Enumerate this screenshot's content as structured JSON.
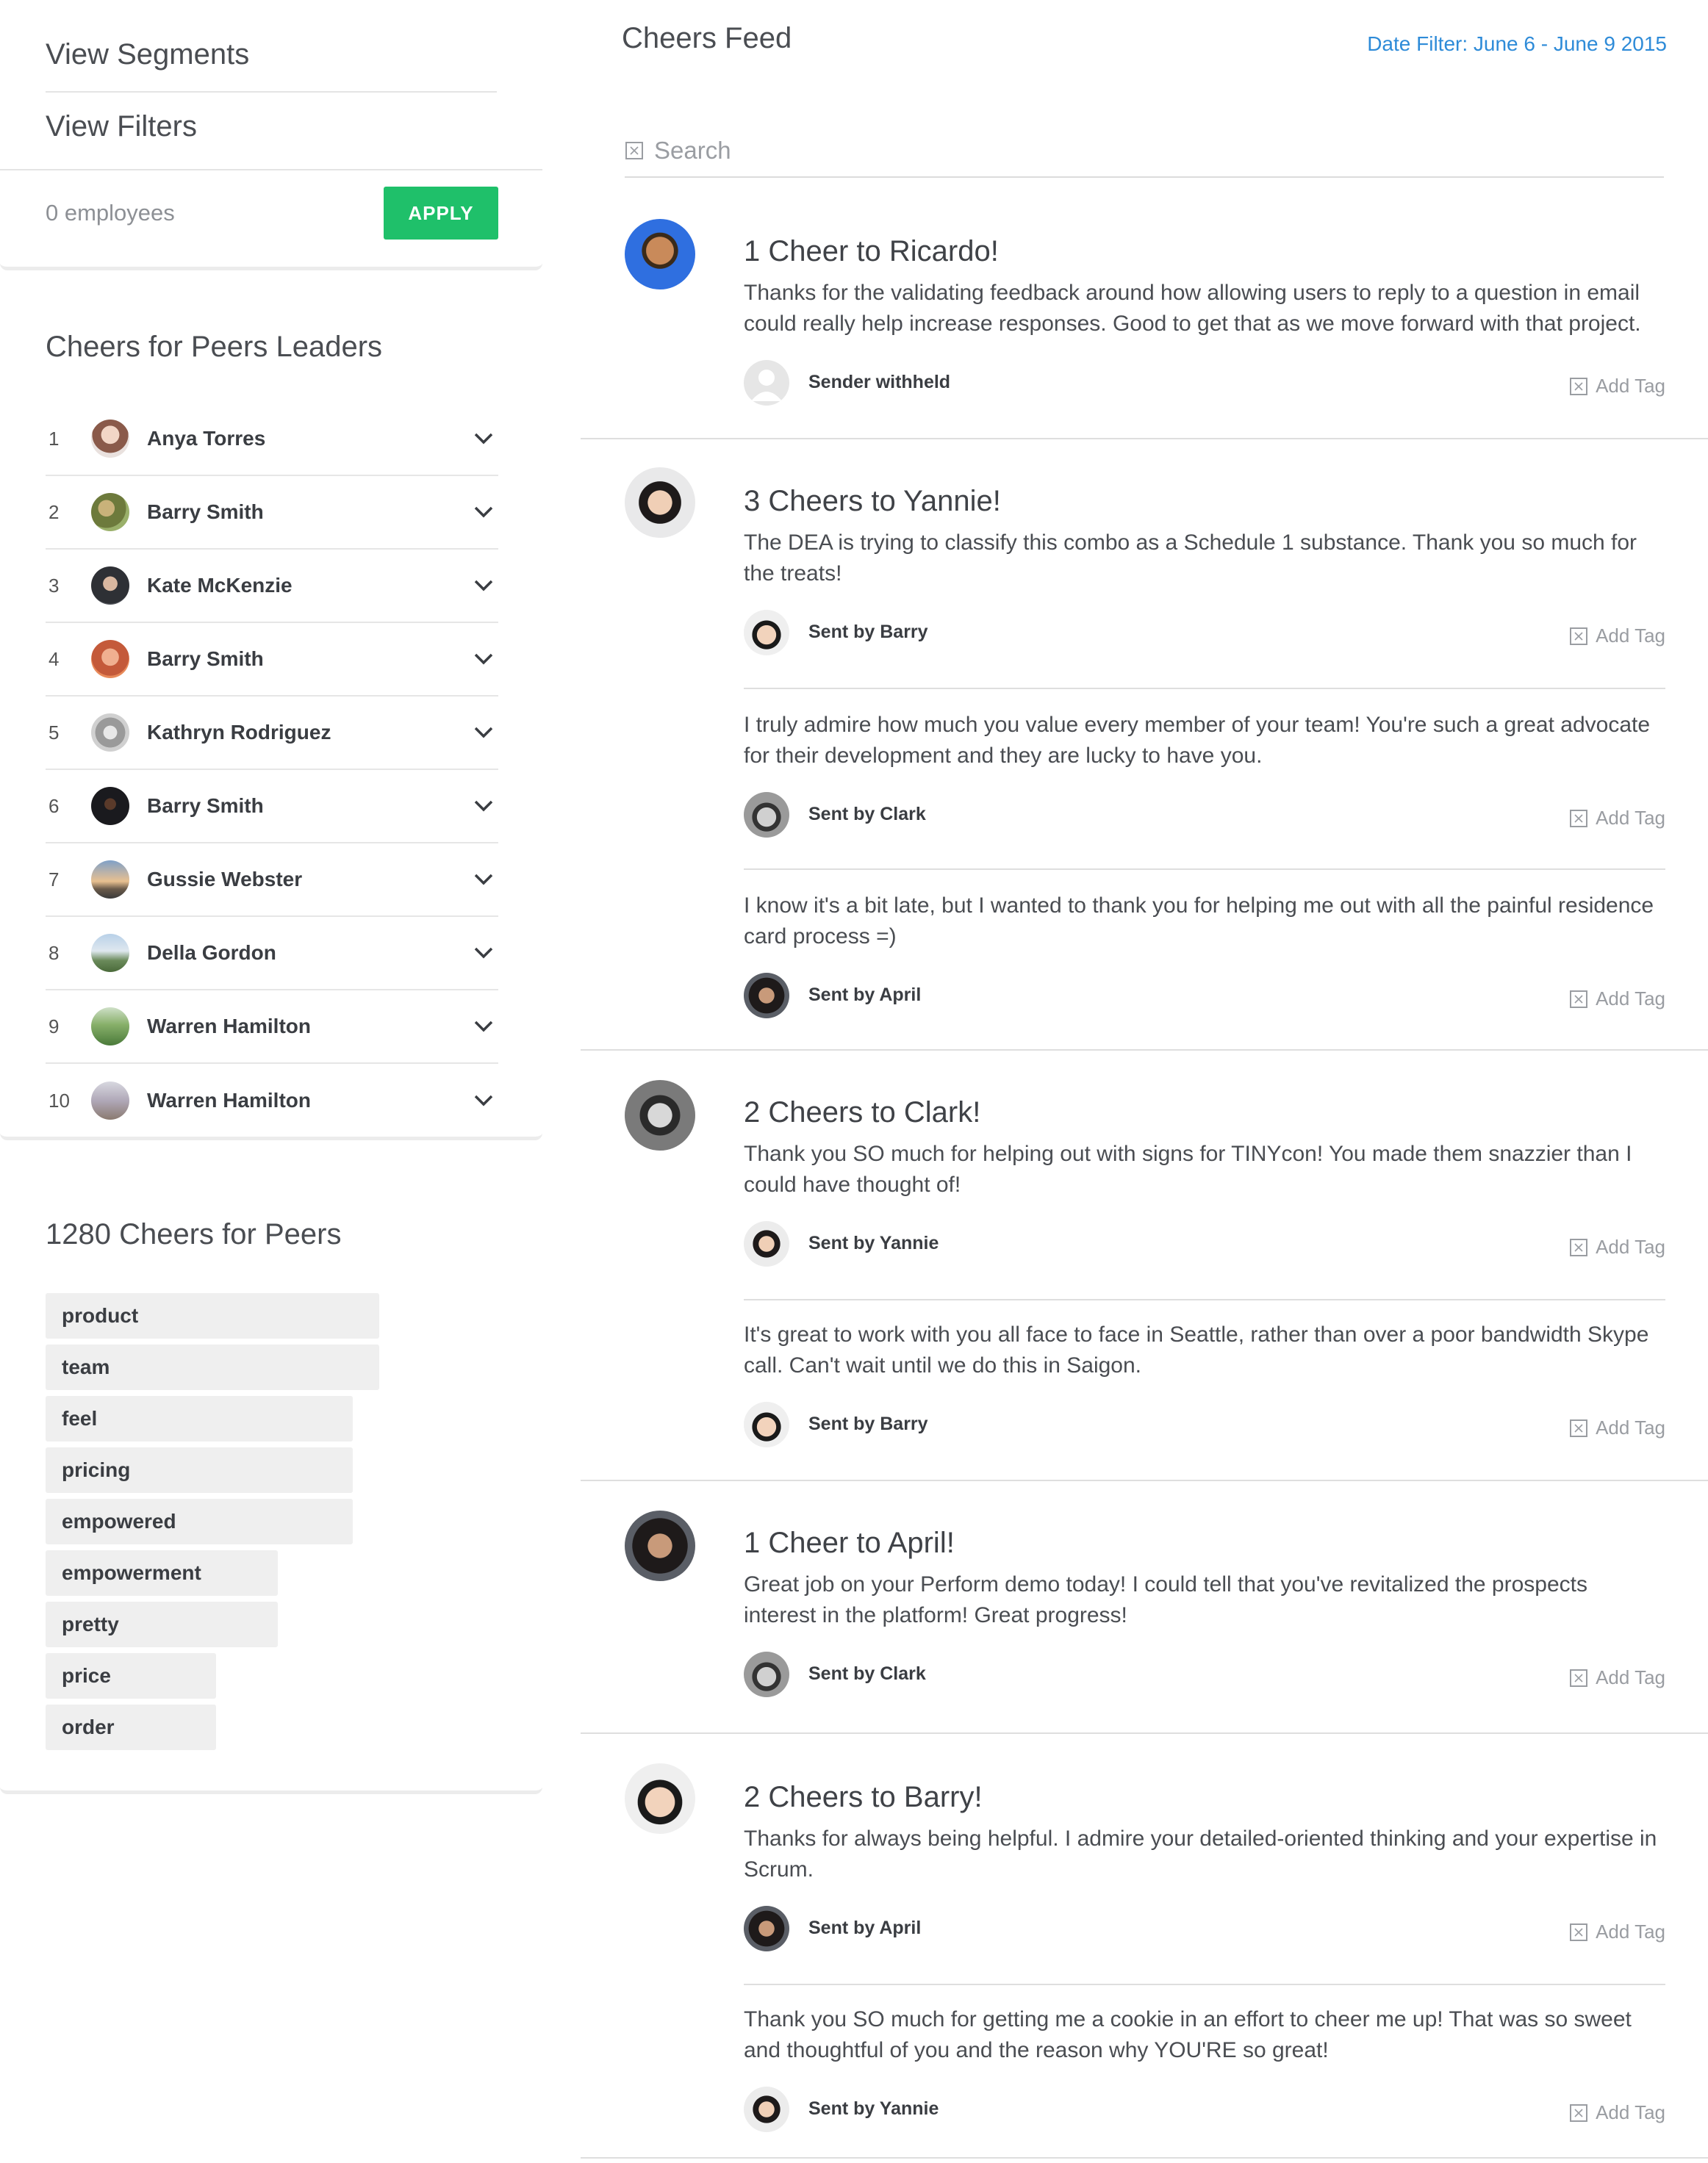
{
  "sidebar": {
    "view_segments": "View Segments",
    "view_filters": "View Filters",
    "employee_count": "0 employees",
    "apply_label": "APPLY",
    "leaders_title": "Cheers for Peers Leaders",
    "leaders": [
      {
        "rank": "1",
        "name": "Anya Torres"
      },
      {
        "rank": "2",
        "name": "Barry Smith"
      },
      {
        "rank": "3",
        "name": "Kate McKenzie"
      },
      {
        "rank": "4",
        "name": "Barry Smith"
      },
      {
        "rank": "5",
        "name": "Kathryn Rodriguez"
      },
      {
        "rank": "6",
        "name": "Barry Smith"
      },
      {
        "rank": "7",
        "name": "Gussie Webster"
      },
      {
        "rank": "8",
        "name": "Della Gordon"
      },
      {
        "rank": "9",
        "name": "Warren Hamilton"
      },
      {
        "rank": "10",
        "name": "Warren Hamilton"
      }
    ],
    "tags_title": "1280 Cheers for Peers",
    "tags": [
      "product",
      "team",
      "feel",
      "pricing",
      "empowered",
      "empowerment",
      "pretty",
      "price",
      "order"
    ]
  },
  "feed": {
    "title": "Cheers Feed",
    "date_filter": "Date Filter: June 6 - June 9 2015",
    "search_placeholder": "Search",
    "add_tag_label": "Add Tag",
    "posts": [
      {
        "title": "1 Cheer to Ricardo!",
        "messages": [
          {
            "text": "Thanks for the validating feedback around how allowing users to reply to a question in email could really help increase responses. Good to get that as we move forward with that project.",
            "sender": "Sender withheld"
          }
        ]
      },
      {
        "title": "3 Cheers to Yannie!",
        "messages": [
          {
            "text": "The DEA is trying to classify this combo as a  Schedule 1 substance. Thank you so much for the treats!",
            "sender": "Sent by Barry"
          },
          {
            "text": "I truly admire how much you value every member of your team! You're such a great advocate for their development and they are lucky to have you.",
            "sender": "Sent by Clark"
          },
          {
            "text": "I know it's a bit late, but I wanted to thank you for helping me out with all the painful residence card process =)",
            "sender": "Sent by April"
          }
        ]
      },
      {
        "title": "2 Cheers to Clark!",
        "messages": [
          {
            "text": "Thank you SO much for helping out with signs for TINYcon! You made them snazzier than I could have thought of!",
            "sender": "Sent by Yannie"
          },
          {
            "text": "It's great to work with you all face to face in Seattle, rather than over a poor bandwidth Skype call. Can't wait until we do this in Saigon.",
            "sender": "Sent by Barry"
          }
        ]
      },
      {
        "title": "1 Cheer to April!",
        "messages": [
          {
            "text": "Great job on your Perform demo today!  I could tell that you've revitalized the prospects interest in the platform!  Great progress!",
            "sender": "Sent by Clark"
          }
        ]
      },
      {
        "title": "2 Cheers to Barry!",
        "messages": [
          {
            "text": "Thanks for always being helpful. I admire your detailed-oriented thinking and your expertise in Scrum.",
            "sender": "Sent by April"
          },
          {
            "text": "Thank you SO much for getting me a cookie in an effort to cheer me up! That was so sweet and thoughtful of you and the reason why YOU'RE so great!",
            "sender": "Sent by Yannie"
          }
        ]
      }
    ]
  }
}
